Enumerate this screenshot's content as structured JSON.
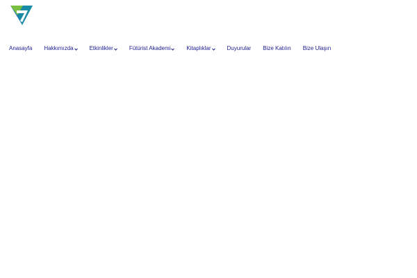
{
  "brand": {
    "logo_icon": "stylized-seven-triangle-logo-icon",
    "colors": {
      "green": "#7ac143",
      "blue": "#1c75bc",
      "teal": "#1a9d8f"
    }
  },
  "nav": {
    "link_color": "#1b1b8f",
    "items": [
      {
        "label": "Anasayfa",
        "has_dropdown": false
      },
      {
        "label": "Hakkımızda",
        "has_dropdown": true
      },
      {
        "label": "Etkinlikler",
        "has_dropdown": true
      },
      {
        "label": "Fütürist Akademi",
        "has_dropdown": true
      },
      {
        "label": "Kitaplıklar",
        "has_dropdown": true
      },
      {
        "label": "Duyurular",
        "has_dropdown": false
      },
      {
        "label": "Bize Katılın",
        "has_dropdown": false
      },
      {
        "label": "Bize Ulaşın",
        "has_dropdown": false
      }
    ]
  }
}
